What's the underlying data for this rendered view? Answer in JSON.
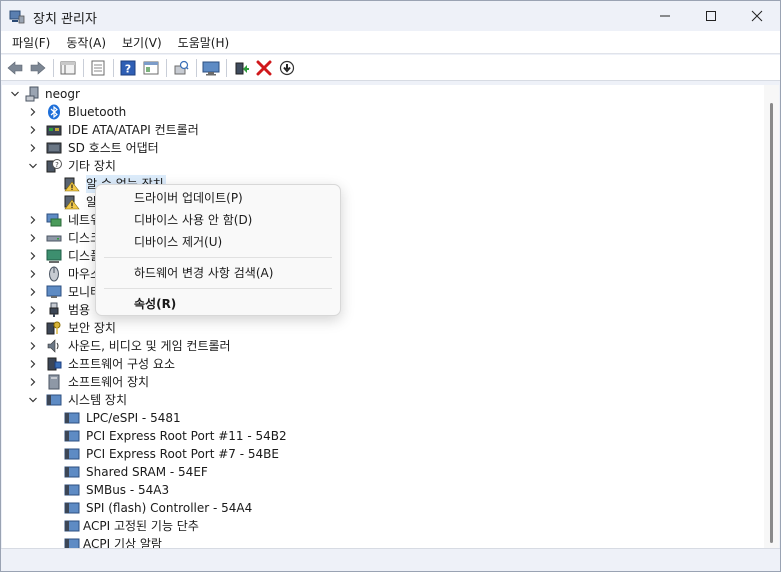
{
  "window": {
    "title": "장치 관리자",
    "controls": [
      "minimize",
      "maximize",
      "close"
    ]
  },
  "menubar": [
    {
      "label": "파일(F)"
    },
    {
      "label": "동작(A)"
    },
    {
      "label": "보기(V)"
    },
    {
      "label": "도움말(H)"
    }
  ],
  "toolbar": [
    "back-icon",
    "forward-icon",
    "properties-icon",
    "view-icon",
    "help-icon",
    "console-icon",
    "scan-icon",
    "monitor-icon",
    "update-driver-icon",
    "uninstall-icon",
    "disable-icon"
  ],
  "tree": {
    "root": "neogr",
    "categories": [
      {
        "label": "Bluetooth",
        "icon": "bluetooth-icon",
        "expanded": false
      },
      {
        "label": "IDE ATA/ATAPI 컨트롤러",
        "icon": "ide-controller-icon",
        "expanded": false
      },
      {
        "label": "SD 호스트 어댑터",
        "icon": "sd-host-icon",
        "expanded": false
      },
      {
        "label": "기타 장치",
        "icon": "other-devices-icon",
        "expanded": true
      },
      {
        "label": "네트워",
        "icon": "network-icon",
        "expanded": false
      },
      {
        "label": "디스크",
        "icon": "disk-icon",
        "expanded": false
      },
      {
        "label": "디스플",
        "icon": "display-icon",
        "expanded": false
      },
      {
        "label": "마우스",
        "icon": "mouse-icon",
        "expanded": false
      },
      {
        "label": "모니터",
        "icon": "monitor-icon",
        "expanded": false
      },
      {
        "label": "범용",
        "icon": "usb-icon",
        "expanded": false
      },
      {
        "label": "보안 장치",
        "icon": "security-device-icon",
        "expanded": false
      },
      {
        "label": "사운드, 비디오 및 게임 컨트롤러",
        "icon": "sound-icon",
        "expanded": false
      },
      {
        "label": "소프트웨어 구성 요소",
        "icon": "software-component-icon",
        "expanded": false
      },
      {
        "label": "소프트웨어 장치",
        "icon": "software-device-icon",
        "expanded": false
      },
      {
        "label": "시스템 장치",
        "icon": "system-device-icon",
        "expanded": true
      }
    ],
    "other_devices": [
      {
        "label": "알 수 없는 장치",
        "selected": true
      },
      {
        "label": "알"
      }
    ],
    "system_devices": [
      "LPC/eSPI - 5481",
      "PCI Express Root Port #11 - 54B2",
      "PCI Express Root Port #7 - 54BE",
      "Shared SRAM - 54EF",
      "SMBus - 54A3",
      "SPI (flash) Controller - 54A4",
      "ACPI 고정된 기능 단추",
      "ACPI 기상 알람"
    ]
  },
  "context_menu": {
    "items": [
      {
        "label": "드라이버 업데이트(P)",
        "bold": false
      },
      {
        "label": "디바이스 사용 안 함(D)",
        "bold": false
      },
      {
        "label": "디바이스 제거(U)",
        "bold": false
      },
      {
        "label": "하드웨어 변경 사항 검색(A)",
        "bold": false
      },
      {
        "label": "속성(R)",
        "bold": true
      }
    ]
  },
  "colors": {
    "window_bg": "#eef1f8",
    "selection": "#dcecfb",
    "bluetooth": "#1e6fd9",
    "uninstall_red": "#d0181b"
  }
}
